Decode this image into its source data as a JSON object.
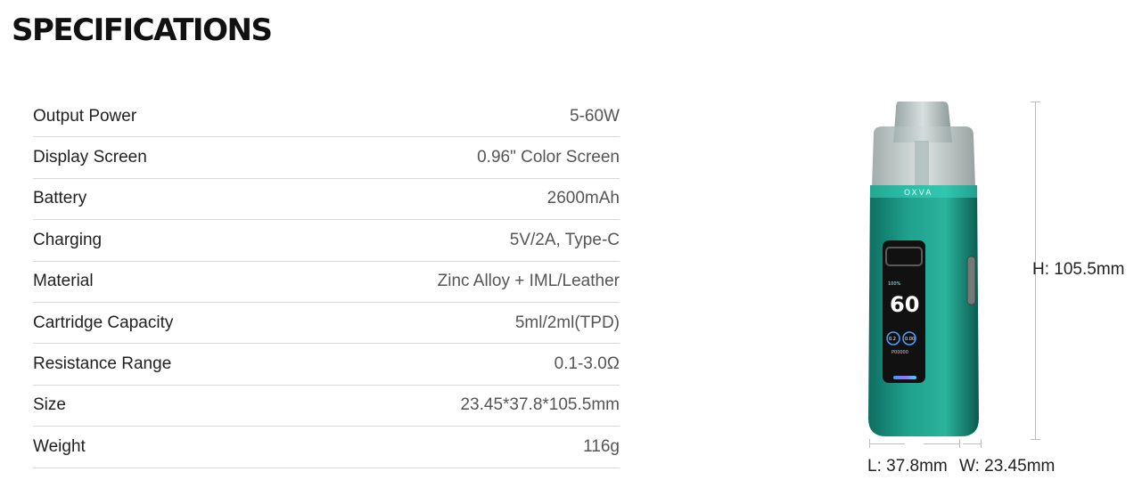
{
  "heading": "SPECIFICATIONS",
  "specs": [
    {
      "label": "Output Power",
      "value": "5-60W"
    },
    {
      "label": "Display Screen",
      "value": "0.96\" Color Screen"
    },
    {
      "label": "Battery",
      "value": "2600mAh"
    },
    {
      "label": "Charging",
      "value": "5V/2A, Type-C"
    },
    {
      "label": "Material",
      "value": "Zinc Alloy + IML/Leather"
    },
    {
      "label": "Cartridge Capacity",
      "value": "5ml/2ml(TPD)"
    },
    {
      "label": "Resistance Range",
      "value": "0.1-3.0Ω"
    },
    {
      "label": "Size",
      "value": "23.45*37.8*105.5mm"
    },
    {
      "label": "Weight",
      "value": "116g"
    }
  ],
  "device": {
    "brand": "OXVA",
    "screen_power": "60",
    "screen_battery": "100%",
    "screen_resistance": "0.2",
    "screen_counter": "0.00",
    "screen_puffs": "P00000",
    "body_color": "#1fa08c",
    "accent_color": "#37d6bf"
  },
  "dimensions": {
    "height": "H: 105.5mm",
    "length": "L: 37.8mm",
    "width": "W: 23.45mm"
  }
}
